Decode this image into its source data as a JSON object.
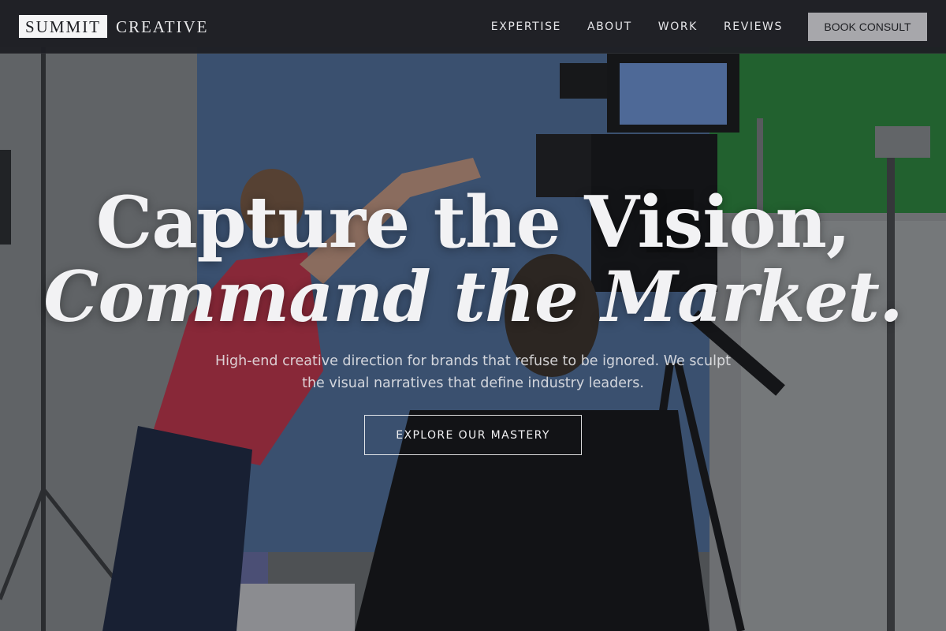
{
  "brand": {
    "logo_box": "SUMMIT",
    "logo_rest": "CREATIVE"
  },
  "nav": {
    "items": [
      {
        "label": "EXPERTISE"
      },
      {
        "label": "ABOUT"
      },
      {
        "label": "WORK"
      },
      {
        "label": "REVIEWS"
      }
    ],
    "cta_label": "BOOK CONSULT"
  },
  "hero": {
    "headline_line1": "Capture the Vision,",
    "headline_line2": "Command the Market.",
    "subtitle": "High-end creative direction for brands that refuse to be ignored. We sculpt the visual narratives that define industry leaders.",
    "button_label": "EXPLORE OUR MASTERY",
    "background_image": "film-set-photo"
  },
  "colors": {
    "header_bg": "#1e1f24",
    "cta_bg": "#a7a7ab",
    "text_light": "#f2f2f4"
  }
}
